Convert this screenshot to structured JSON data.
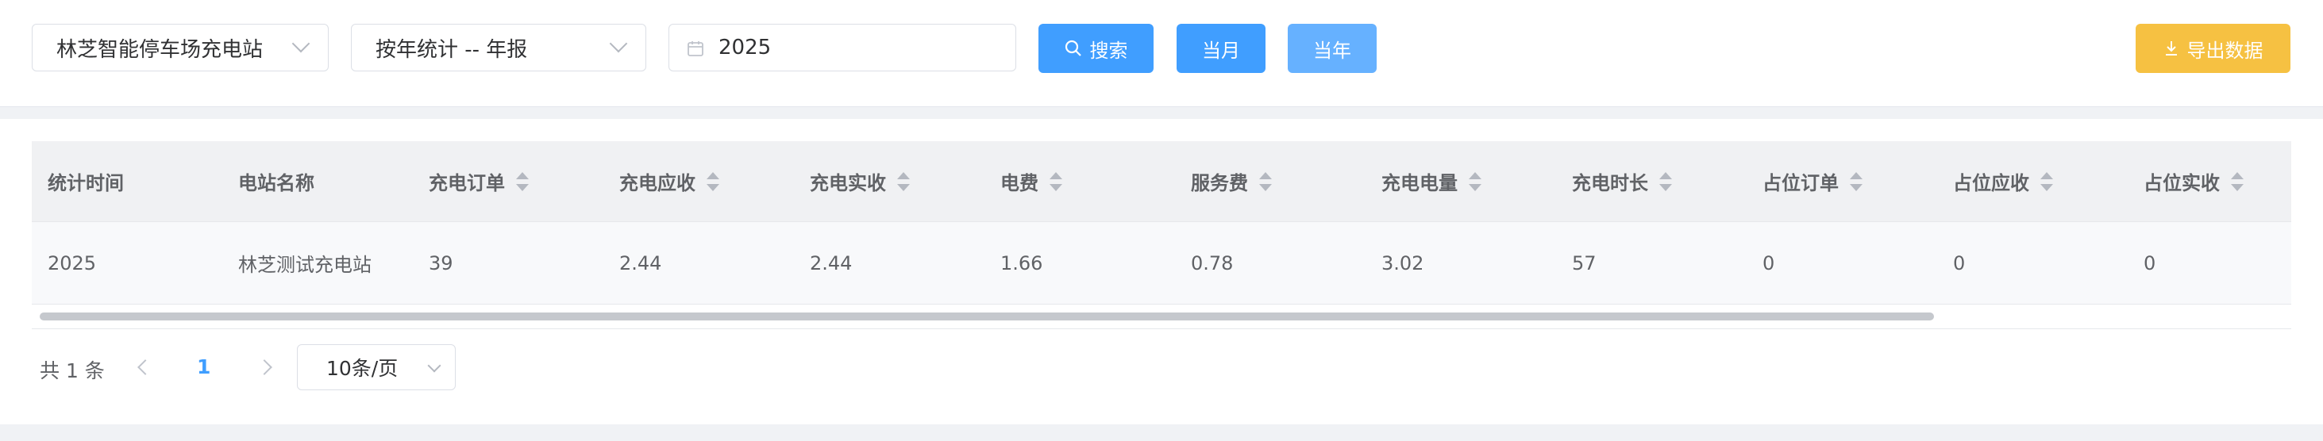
{
  "filters": {
    "station_select": "林芝智能停车场充电站",
    "period_select": "按年统计 -- 年报",
    "date_value": "2025"
  },
  "buttons": {
    "search": "搜索",
    "this_month": "当月",
    "this_year": "当年",
    "export": "导出数据"
  },
  "colors": {
    "primary": "#409eff",
    "primary_light": "#66b1ff",
    "export": "#f6c142"
  },
  "table": {
    "columns": [
      "统计时间",
      "电站名称",
      "充电订单",
      "充电应收",
      "充电实收",
      "电费",
      "服务费",
      "充电电量",
      "充电时长",
      "占位订单",
      "占位应收",
      "占位实收"
    ],
    "sortable": [
      false,
      false,
      true,
      true,
      true,
      true,
      true,
      true,
      true,
      true,
      true,
      true
    ],
    "rows": [
      [
        "2025",
        "林芝测试充电站",
        "39",
        "2.44",
        "2.44",
        "1.66",
        "0.78",
        "3.02",
        "57",
        "0",
        "0",
        "0"
      ]
    ]
  },
  "pagination": {
    "total_text": "共 1 条",
    "current_page": "1",
    "page_size": "10条/页"
  }
}
